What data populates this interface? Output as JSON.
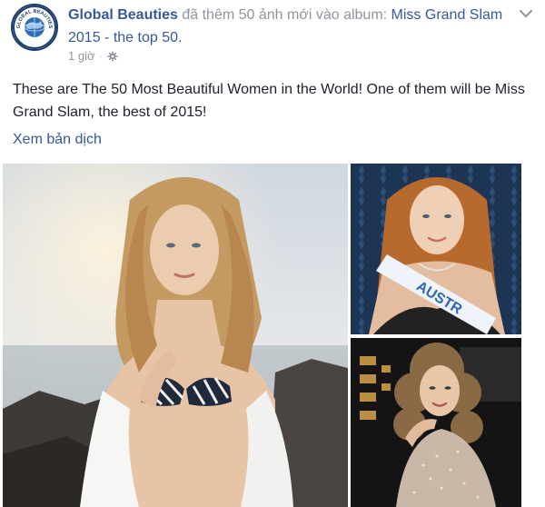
{
  "post": {
    "page_name": "Global Beauties",
    "action_text": " đã thêm 50 ảnh mới vào album: ",
    "album_name": "Miss Grand Slam 2015 - the top 50.",
    "timestamp": "1 giờ",
    "separator": "·",
    "privacy_icon": "gear-icon",
    "body_text": "These are The 50 Most Beautiful Women in the World! One of them will be Miss Grand Slam, the best of 2015!",
    "see_translation": "Xem bản dịch",
    "avatar_text": "GLOBAL BEAUTIES",
    "sash_text": "AUSTR"
  },
  "colors": {
    "link": "#365899",
    "meta": "#90949c",
    "text": "#1d2129",
    "avatar_ring": "#1a3d6b"
  },
  "icons": {
    "options": "chevron-down-icon",
    "privacy": "gear-icon"
  }
}
